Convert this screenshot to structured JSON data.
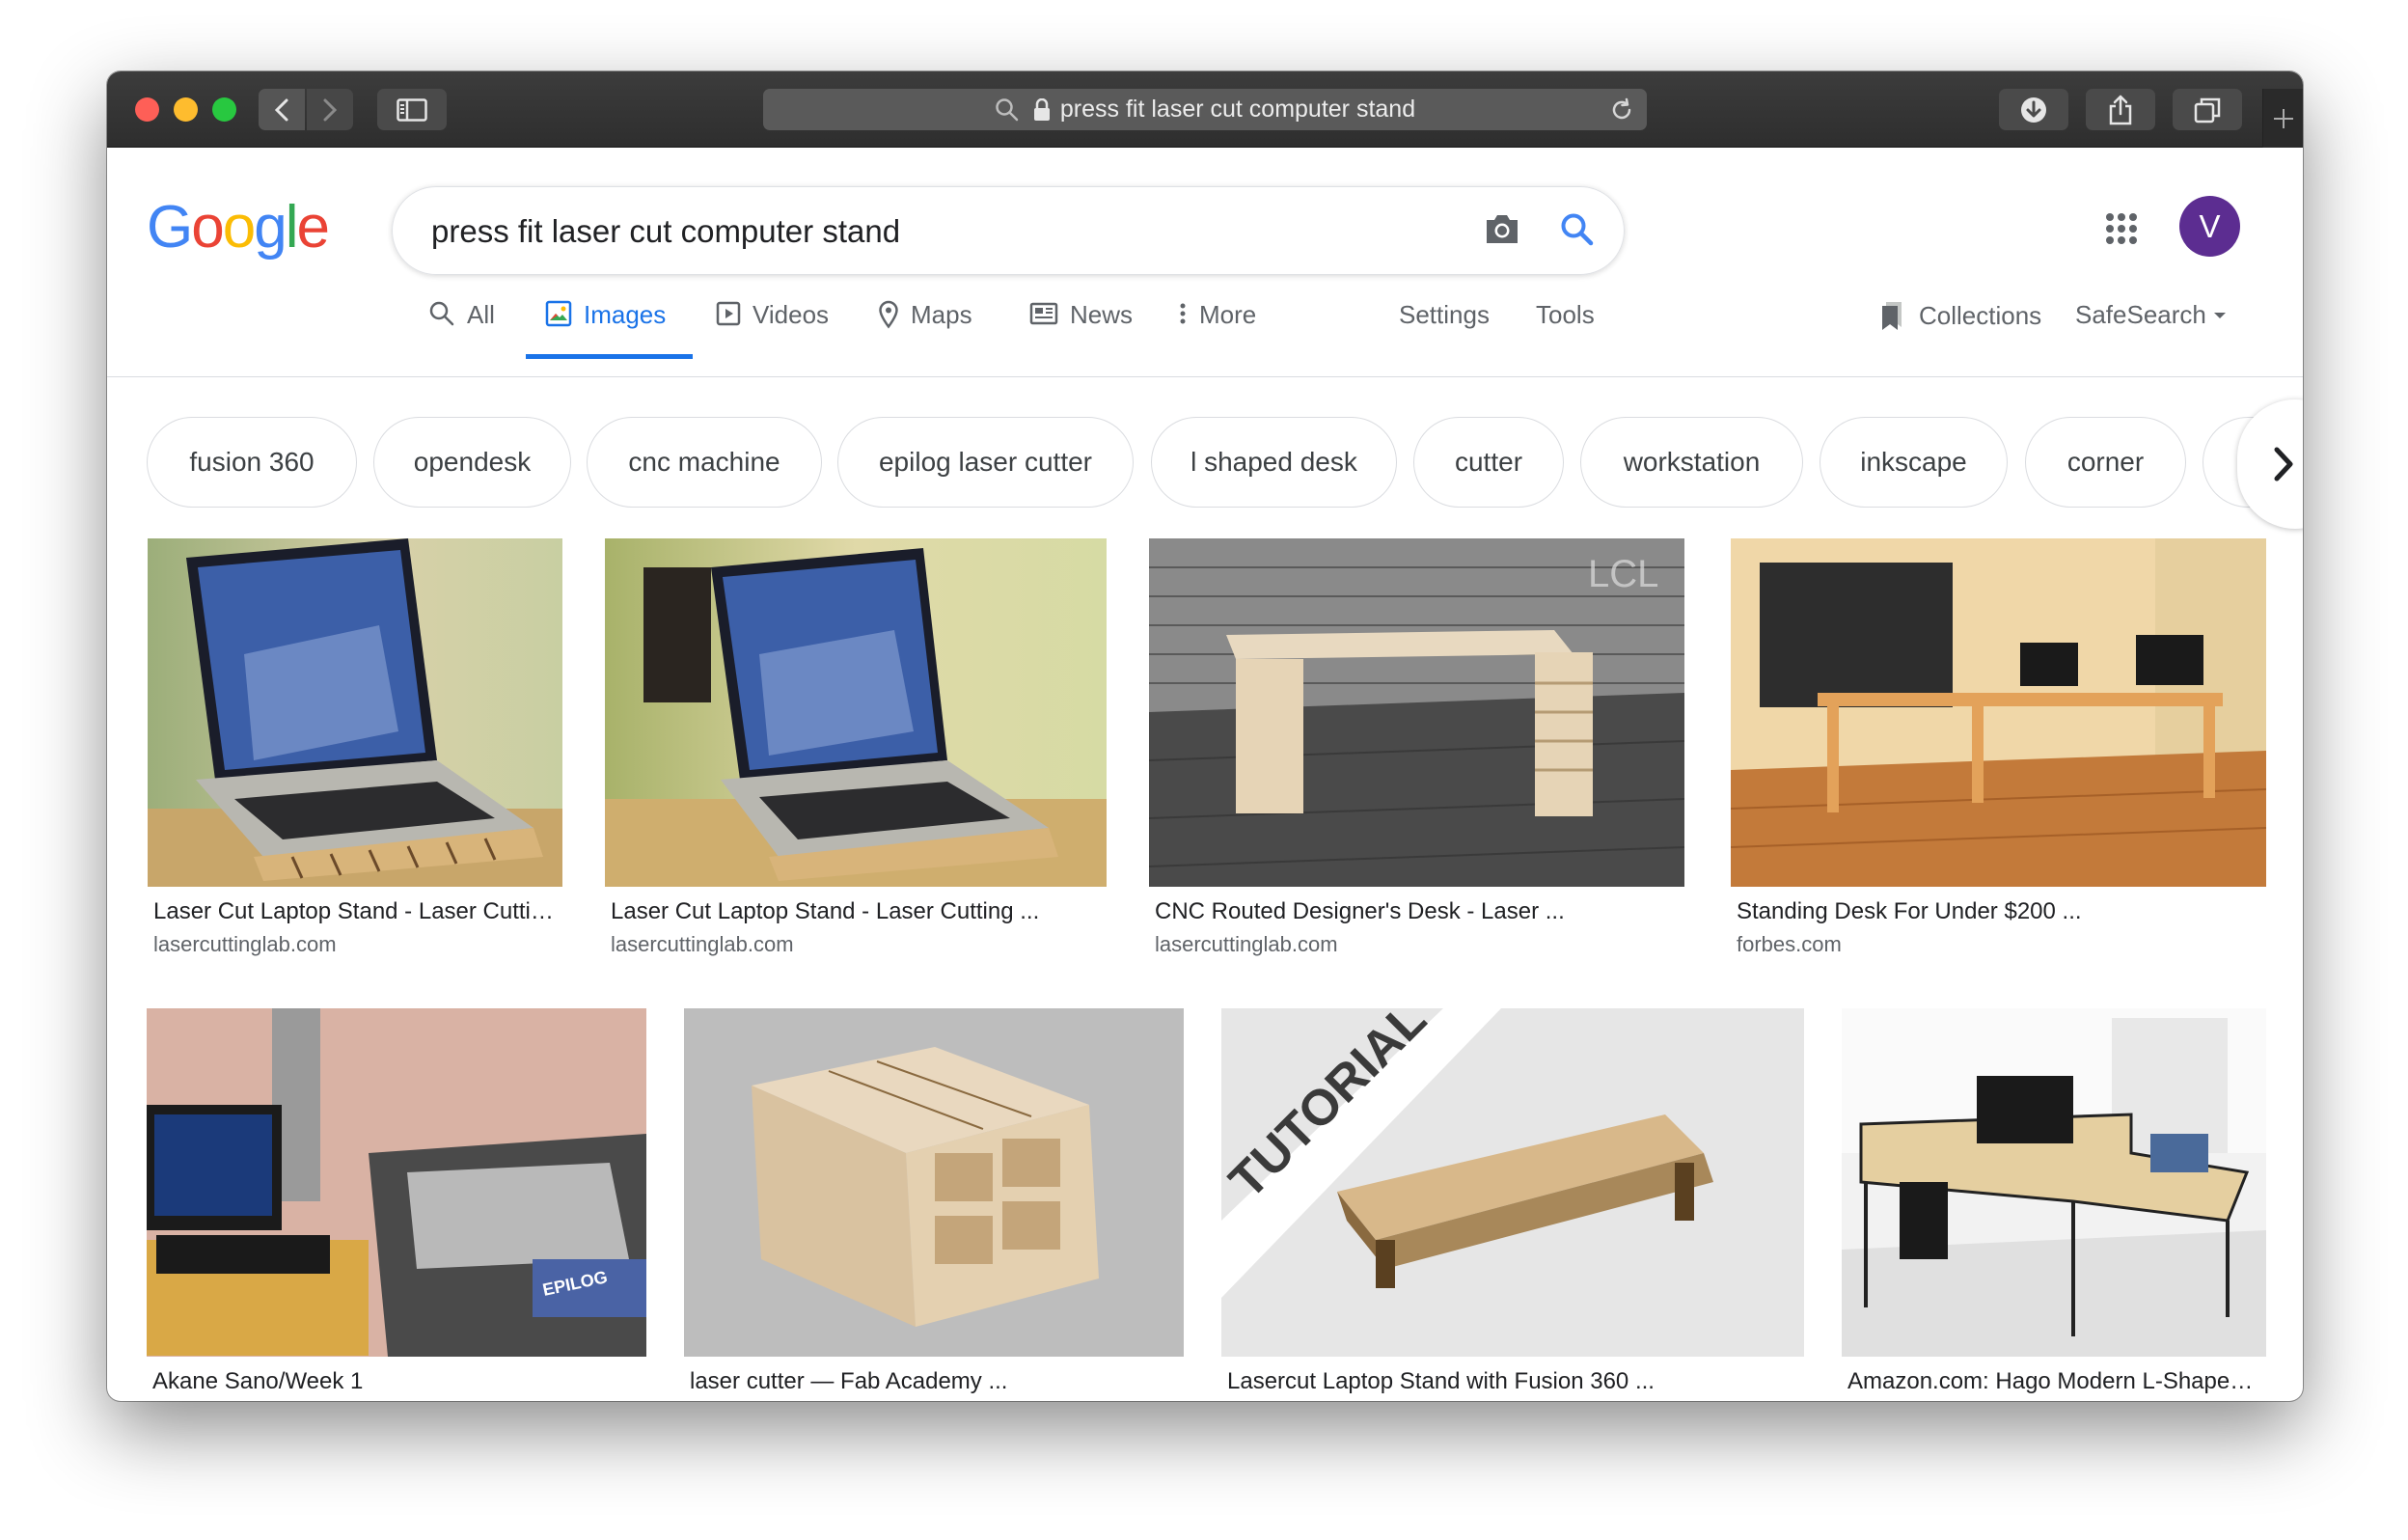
{
  "browser": {
    "url_text": "press fit laser cut computer stand"
  },
  "google": {
    "logo_letters": [
      "G",
      "o",
      "o",
      "g",
      "l",
      "e"
    ],
    "logo_colors": [
      "#4285f4",
      "#ea4335",
      "#fbbc05",
      "#4285f4",
      "#34a853",
      "#ea4335"
    ],
    "search_value": "press fit laser cut computer stand",
    "avatar_letter": "V",
    "avatar_color": "#5c2d91"
  },
  "tabs": {
    "all": "All",
    "images": "Images",
    "videos": "Videos",
    "maps": "Maps",
    "news": "News",
    "more": "More",
    "settings": "Settings",
    "tools": "Tools",
    "collections": "Collections",
    "safesearch": "SafeSearch"
  },
  "chips": [
    "fusion 360",
    "opendesk",
    "cnc machine",
    "epilog laser cutter",
    "l shaped desk",
    "cutter",
    "workstation",
    "inkscape",
    "corner"
  ],
  "results": [
    {
      "title": "Laser Cut Laptop Stand - Laser Cutti…",
      "source": "lasercuttinglab.com",
      "icon": "laptop-stand-image"
    },
    {
      "title": "Laser Cut Laptop Stand - Laser Cutting ...",
      "source": "lasercuttinglab.com",
      "icon": "laptop-stand-image"
    },
    {
      "title": "CNC Routed Designer's Desk - Laser ...",
      "source": "lasercuttinglab.com",
      "icon": "desk-image"
    },
    {
      "title": "Standing Desk For Under $200 ...",
      "source": "forbes.com",
      "icon": "standing-desk-image"
    },
    {
      "title": "Akane Sano/Week 1",
      "source": "",
      "icon": "laser-cutter-image"
    },
    {
      "title": "laser cutter — Fab Academy ...",
      "source": "",
      "icon": "organizer-box-image"
    },
    {
      "title": "Lasercut Laptop Stand with Fusion 360 ...",
      "source": "",
      "icon": "laptop-stand-tutorial-image"
    },
    {
      "title": "Amazon.com: Hago Modern L-Shape…",
      "source": "",
      "icon": "l-shaped-desk-image"
    }
  ],
  "thumb_overlays": {
    "tutorial_text": "TUTORIAL",
    "epilog_text": "EPILOG"
  }
}
